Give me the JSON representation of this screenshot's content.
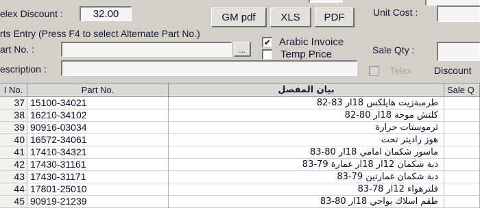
{
  "top": {
    "discount_label": "elex Discount :",
    "discount_value": "32.00",
    "unit_cost_label": "Unit Cost :",
    "gm_pdf": "GM pdf",
    "xls": "XLS",
    "pdf": "PDF"
  },
  "parts": {
    "heading": "rts Entry (Press F4 to select Alternate Part No.)",
    "part_no_label": "art No. :",
    "browse_label": "...",
    "description_label": "escription :",
    "arabic_invoice_label": "Arabic Invoice",
    "arabic_invoice_checked": true,
    "temp_price_label": "Temp Price",
    "temp_price_checked": false,
    "sale_qty_label": "Sale Qty :",
    "telex_label": "Telex",
    "discount_label": "Discount"
  },
  "grid": {
    "headers": [
      "I No.",
      "Part No.",
      "بيان المفصل",
      "Sale Q"
    ],
    "rows": [
      {
        "no": "37",
        "part": "15100-34021",
        "desc": "طرمبةزيت هايلكس 18ار 83-82"
      },
      {
        "no": "38",
        "part": "16210-34102",
        "desc": "كلتش موحة 18ار 80-82"
      },
      {
        "no": "39",
        "part": "90916-03034",
        "desc": "ثرموستات حرارة"
      },
      {
        "no": "40",
        "part": "16572-34061",
        "desc": "هوز راديتر تحت"
      },
      {
        "no": "41",
        "part": "17410-34321",
        "desc": "ماسور شكمان امامي 18ار 80-83"
      },
      {
        "no": "42",
        "part": "17430-31161",
        "desc": "دبة شكمان 12ار 18ار غمارة 79-83"
      },
      {
        "no": "43",
        "part": "17430-31171",
        "desc": "دبة شكمان غمارتين 79-83"
      },
      {
        "no": "44",
        "part": "17801-25010",
        "desc": "فلترهواء 12ار 78-83"
      },
      {
        "no": "45",
        "part": "90919-21239",
        "desc": "طقم اسلاك بواجي 18ار 80-83"
      }
    ]
  }
}
